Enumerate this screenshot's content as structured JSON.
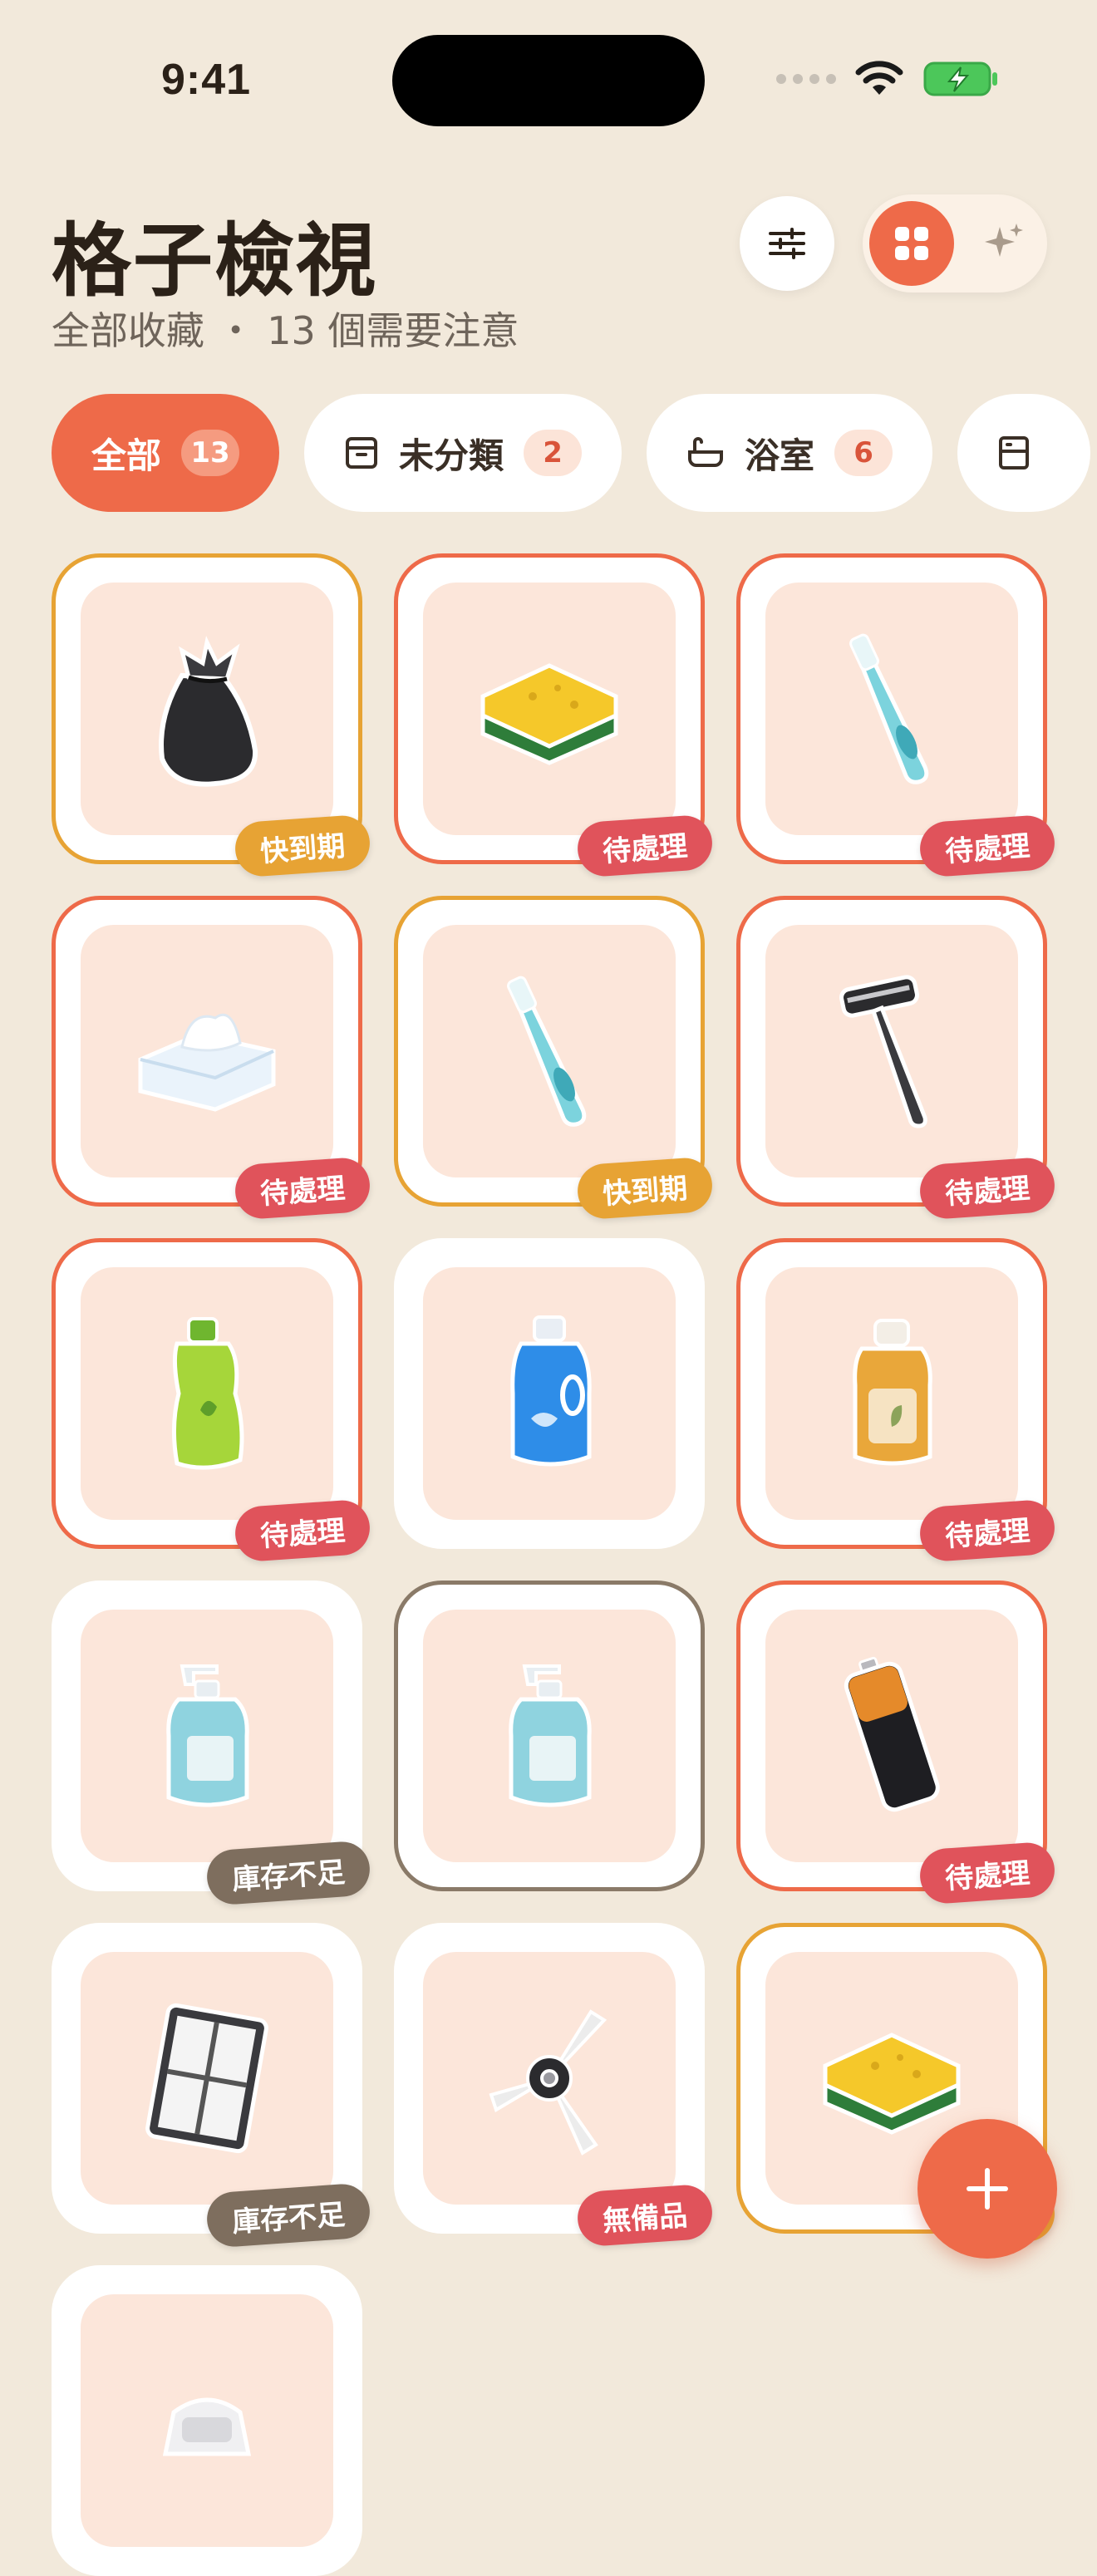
{
  "status_bar": {
    "time": "9:41"
  },
  "header": {
    "title": "格子檢視",
    "subtitle": "全部收藏 ・ 13 個需要注意"
  },
  "toolbar": {
    "filter_icon": "sliders-icon",
    "view_grid_icon": "grid-icon",
    "view_ai_icon": "sparkles-icon"
  },
  "categories": [
    {
      "label": "全部",
      "count": "13",
      "active": true
    },
    {
      "label": "未分類",
      "count": "2",
      "icon": "archive-box-icon"
    },
    {
      "label": "浴室",
      "count": "6",
      "icon": "bathtub-icon"
    },
    {
      "label": "",
      "count": "",
      "icon": "cabinet-icon"
    }
  ],
  "items": [
    {
      "icon": "trash-bag",
      "status": "快到期",
      "tone": "yellow"
    },
    {
      "icon": "sponge",
      "status": "待處理",
      "tone": "red"
    },
    {
      "icon": "toothbrush",
      "status": "待處理",
      "tone": "red"
    },
    {
      "icon": "tissue-box",
      "status": "待處理",
      "tone": "red"
    },
    {
      "icon": "toothbrush",
      "status": "快到期",
      "tone": "yellow"
    },
    {
      "icon": "razor",
      "status": "待處理",
      "tone": "red"
    },
    {
      "icon": "dish-soap",
      "status": "待處理",
      "tone": "red"
    },
    {
      "icon": "detergent-bottle",
      "status": "",
      "tone": "none"
    },
    {
      "icon": "oil-bottle",
      "status": "待處理",
      "tone": "red"
    },
    {
      "icon": "pump-bottle",
      "status": "庫存不足",
      "tone": "brown"
    },
    {
      "icon": "pump-bottle",
      "status": "",
      "tone": "brown"
    },
    {
      "icon": "battery",
      "status": "待處理",
      "tone": "red"
    },
    {
      "icon": "hepa-filter",
      "status": "庫存不足",
      "tone": "brown"
    },
    {
      "icon": "side-brush",
      "status": "無備品",
      "tone": "red"
    },
    {
      "icon": "sponge",
      "status": "",
      "tone": "yellow"
    },
    {
      "icon": "water-filter",
      "status": "",
      "tone": "none"
    }
  ],
  "fab": {
    "icon": "plus-icon"
  },
  "colors": {
    "accent": "#EE6A49",
    "background": "#F2E9DB",
    "warning": "#E7A334",
    "danger": "#E0535B",
    "muted": "#7E6E5E"
  }
}
